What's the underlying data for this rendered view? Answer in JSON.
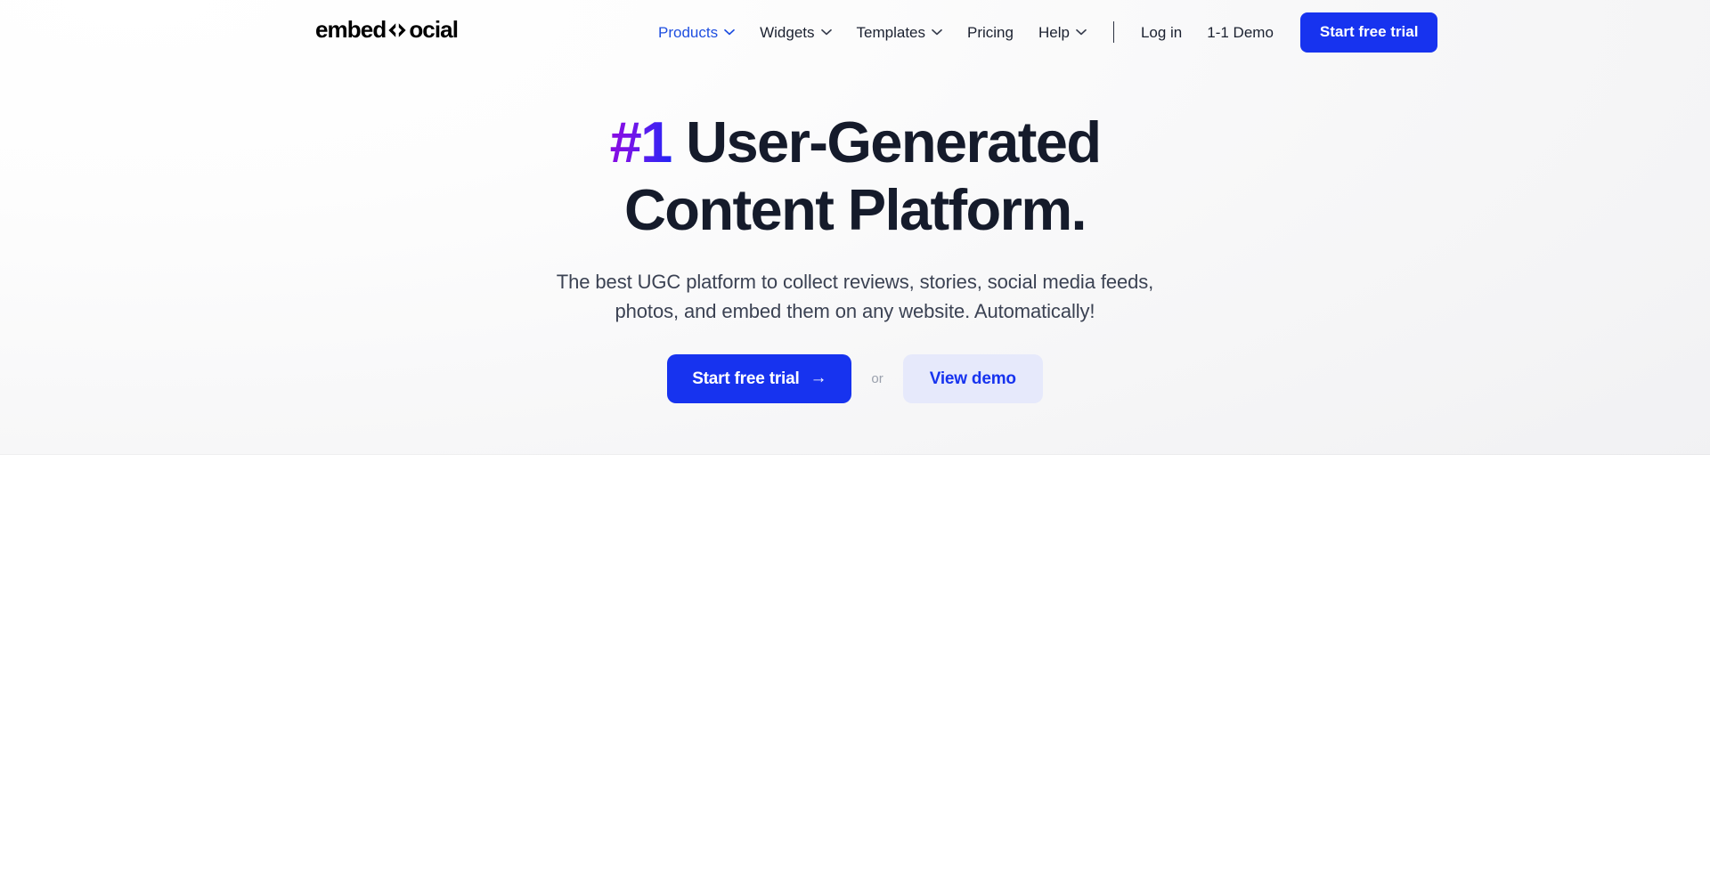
{
  "brand": {
    "logo_text_left": "embed",
    "logo_mark": "code-brackets-icon",
    "logo_text_right": "ocial",
    "accent_blue": "#1733ef",
    "accent_purple": "#8b0ae0",
    "heading_color": "#151b2b"
  },
  "nav": {
    "links": [
      {
        "label": "Products",
        "has_chevron": true,
        "active": true
      },
      {
        "label": "Widgets",
        "has_chevron": true,
        "active": false
      },
      {
        "label": "Templates",
        "has_chevron": true,
        "active": false
      },
      {
        "label": "Pricing",
        "has_chevron": false,
        "active": false
      },
      {
        "label": "Help",
        "has_chevron": true,
        "active": false
      }
    ],
    "login_label": "Log in",
    "demo_label": "1-1 Demo",
    "trial_button_label": "Start free trial"
  },
  "hero": {
    "title_accent": "#1",
    "title_rest": " User-Generated",
    "title_line2": "Content Platform.",
    "subtitle_line1": "The best UGC platform to collect reviews, stories, social media",
    "subtitle_line2": "feeds, photos, and embed them on any website. Automatically!",
    "primary_cta": "Start free trial",
    "primary_cta_arrow": "→",
    "or_label": "or",
    "secondary_cta": "View demo"
  }
}
